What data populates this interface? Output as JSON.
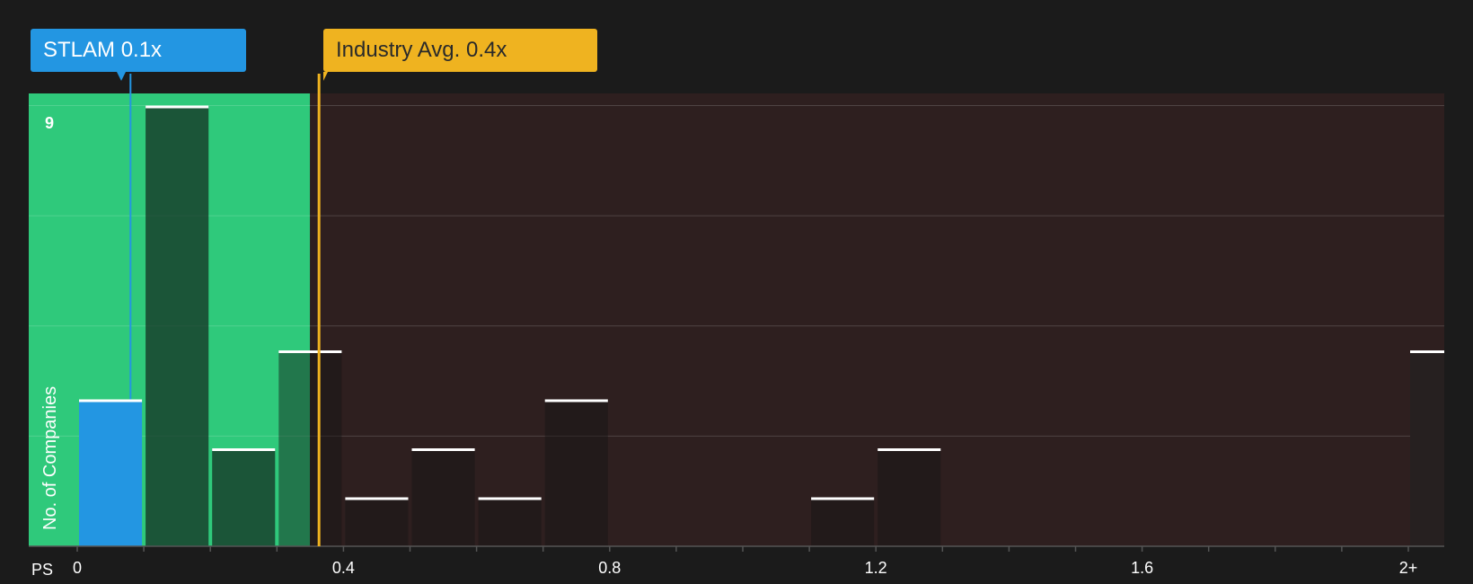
{
  "company_label": {
    "name": "STLAM",
    "value": "0.1x"
  },
  "industry_label": {
    "name": "Industry Avg.",
    "value": "0.4x"
  },
  "colors": {
    "company": "#2396e2",
    "industry": "#efb320",
    "below_avg_zone": "#2fc97b",
    "above_avg_zone": "#2e1f1f",
    "background": "#1b1b1b"
  },
  "chart_data": {
    "type": "bar",
    "metric_label": "PS",
    "ylabel": "No. of Companies",
    "y_tick_labels": [
      "9"
    ],
    "ylim": [
      0,
      9
    ],
    "x_tick_labels": [
      "0",
      "0.4",
      "0.8",
      "1.2",
      "1.6",
      "2+"
    ],
    "x_tick_values": [
      0,
      0.4,
      0.8,
      1.2,
      1.6,
      2.0
    ],
    "xlim": [
      0,
      2.05
    ],
    "bin_width": 0.1,
    "company_value": 0.08,
    "industry_avg": 0.37,
    "bins": [
      {
        "start": 0.0,
        "count": 3,
        "company": true
      },
      {
        "start": 0.1,
        "count": 9
      },
      {
        "start": 0.2,
        "count": 2
      },
      {
        "start": 0.3,
        "count": 4
      },
      {
        "start": 0.4,
        "count": 1
      },
      {
        "start": 0.5,
        "count": 2
      },
      {
        "start": 0.6,
        "count": 1
      },
      {
        "start": 0.7,
        "count": 3
      },
      {
        "start": 1.1,
        "count": 1
      },
      {
        "start": 1.2,
        "count": 2
      },
      {
        "start": 2.0,
        "count": 4,
        "overflow": true
      }
    ]
  }
}
